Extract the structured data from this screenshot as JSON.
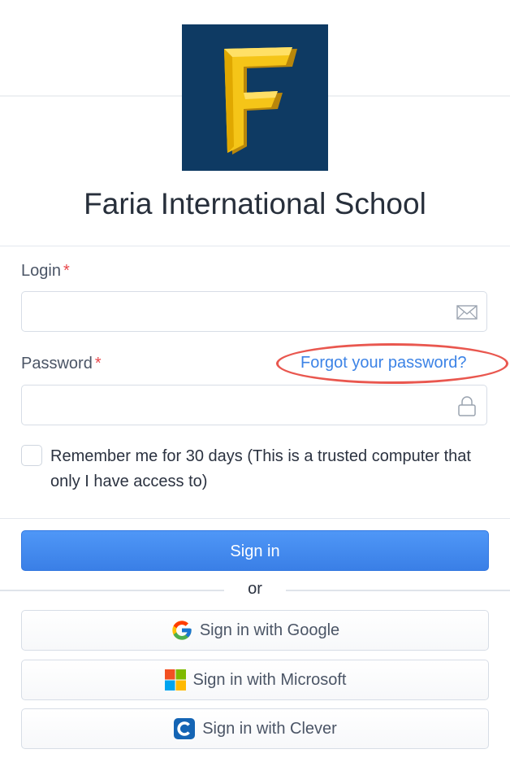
{
  "school": {
    "name": "Faria International School",
    "logo_letter": "F"
  },
  "login": {
    "label": "Login",
    "required_marker": "*",
    "value": "",
    "icon": "envelope-icon"
  },
  "password": {
    "label": "Password",
    "required_marker": "*",
    "value": "",
    "icon": "lock-icon",
    "forgot_link": "Forgot your password?"
  },
  "remember": {
    "checked": false,
    "label": "Remember me for 30 days (This is a trusted computer that only I have access to)"
  },
  "actions": {
    "sign_in": "Sign in",
    "separator": "or",
    "sso": [
      {
        "label": "Sign in with Google",
        "icon": "google-icon"
      },
      {
        "label": "Sign in with Microsoft",
        "icon": "microsoft-icon"
      },
      {
        "label": "Sign in with Clever",
        "icon": "clever-icon"
      }
    ]
  },
  "colors": {
    "primary": "#3a82ec",
    "link": "#3c83e6",
    "required": "#e8474b",
    "highlight_ring": "#e9574f",
    "logo_bg": "#0e3a63",
    "logo_gold": "#f5c518"
  }
}
